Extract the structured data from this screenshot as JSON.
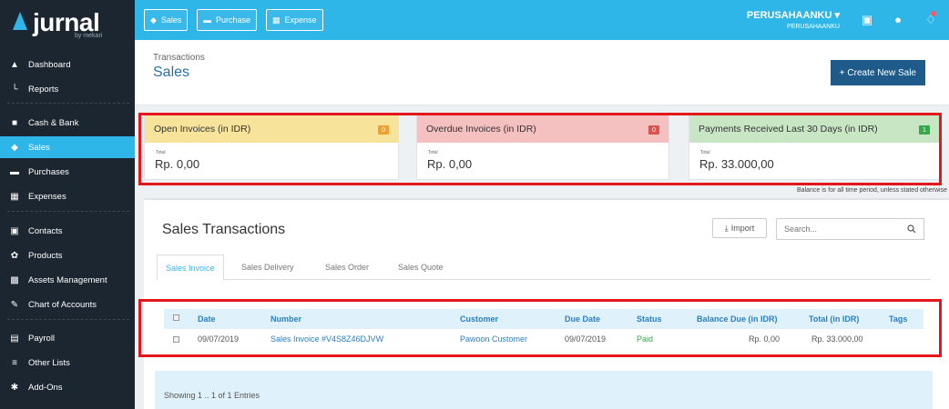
{
  "app": {
    "logo": "jurnal",
    "logo_sub": "by mekari"
  },
  "sidebar": {
    "items": [
      {
        "label": "Dashboard",
        "icon": "dashboard-icon"
      },
      {
        "label": "Reports",
        "icon": "reports-icon"
      },
      {
        "label": "Cash & Bank",
        "icon": "bank-icon"
      },
      {
        "label": "Sales",
        "icon": "sales-tag-icon",
        "active": true
      },
      {
        "label": "Purchases",
        "icon": "purchases-icon"
      },
      {
        "label": "Expenses",
        "icon": "expenses-icon"
      },
      {
        "label": "Contacts",
        "icon": "contacts-icon"
      },
      {
        "label": "Products",
        "icon": "products-icon"
      },
      {
        "label": "Assets Management",
        "icon": "assets-icon"
      },
      {
        "label": "Chart of Accounts",
        "icon": "accounts-icon"
      },
      {
        "label": "Payroll",
        "icon": "payroll-icon"
      },
      {
        "label": "Other Lists",
        "icon": "list-icon"
      },
      {
        "label": "Add-Ons",
        "icon": "puzzle-icon"
      }
    ]
  },
  "topbar": {
    "sales_label": "Sales",
    "purchase_label": "Purchase",
    "expense_label": "Expense",
    "company_name": "PERUSAHAANKU",
    "company_sub": "PERUSAHAANKU",
    "colors": {
      "accent": "#2fb6e8"
    }
  },
  "header": {
    "breadcrumb": "Transactions",
    "title": "Sales",
    "create_button": "+ Create New Sale"
  },
  "cards": [
    {
      "title": "Open Invoices (in IDR)",
      "badge": "0",
      "sub": "Total",
      "value": "Rp. 0,00",
      "color": "#f7e39a",
      "badge_color": "#f0a030"
    },
    {
      "title": "Overdue Invoices (in IDR)",
      "badge": "0",
      "sub": "Total",
      "value": "Rp. 0,00",
      "color": "#f5c0c0",
      "badge_color": "#d9534f"
    },
    {
      "title": "Payments Received Last 30 Days (in IDR)",
      "badge": "1",
      "sub": "Total",
      "value": "Rp. 33.000,00",
      "color": "#c8e6c4",
      "badge_color": "#3aa64c"
    }
  ],
  "balance_note": "Balance is for all time period, unless stated otherwise",
  "main": {
    "title": "Sales Transactions",
    "import_label": "Import",
    "search_placeholder": "Search...",
    "tabs": [
      "Sales Invoice",
      "Sales Delivery",
      "Sales Order",
      "Sales Quote"
    ],
    "columns": [
      "Date",
      "Number",
      "Customer",
      "Due Date",
      "Status",
      "Balance Due (in IDR)",
      "Total (in IDR)",
      "Tags"
    ],
    "rows": [
      {
        "date": "09/07/2019",
        "number": "Sales Invoice #V4S8Z46DJVW",
        "customer": "Pawoon Customer",
        "due_date": "09/07/2019",
        "status": "Paid",
        "balance_due": "Rp. 0,00",
        "total": "Rp. 33.000,00",
        "tags": ""
      }
    ],
    "footer": "Showing 1 .. 1 of 1 Entries"
  }
}
